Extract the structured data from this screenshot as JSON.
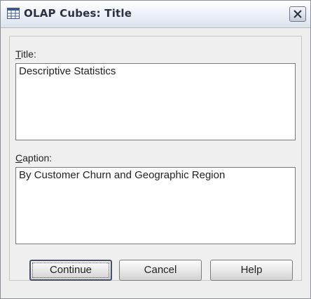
{
  "window": {
    "title": "OLAP Cubes: Title",
    "icon": "table-grid-icon",
    "close_icon": "close-x-icon"
  },
  "form": {
    "title_label": "Title:",
    "title_mnemonic": "T",
    "title_label_rest": "itle:",
    "title_value": "Descriptive Statistics",
    "caption_label": "Caption:",
    "caption_mnemonic": "C",
    "caption_label_rest": "aption:",
    "caption_value": "By Customer Churn and Geographic Region"
  },
  "buttons": {
    "continue_label": "Continue",
    "cancel_label": "Cancel",
    "help_label": "Help"
  },
  "colors": {
    "dialog_background": "#eeeeee",
    "title_text": "#2a3140",
    "focus_border": "#44506a"
  }
}
